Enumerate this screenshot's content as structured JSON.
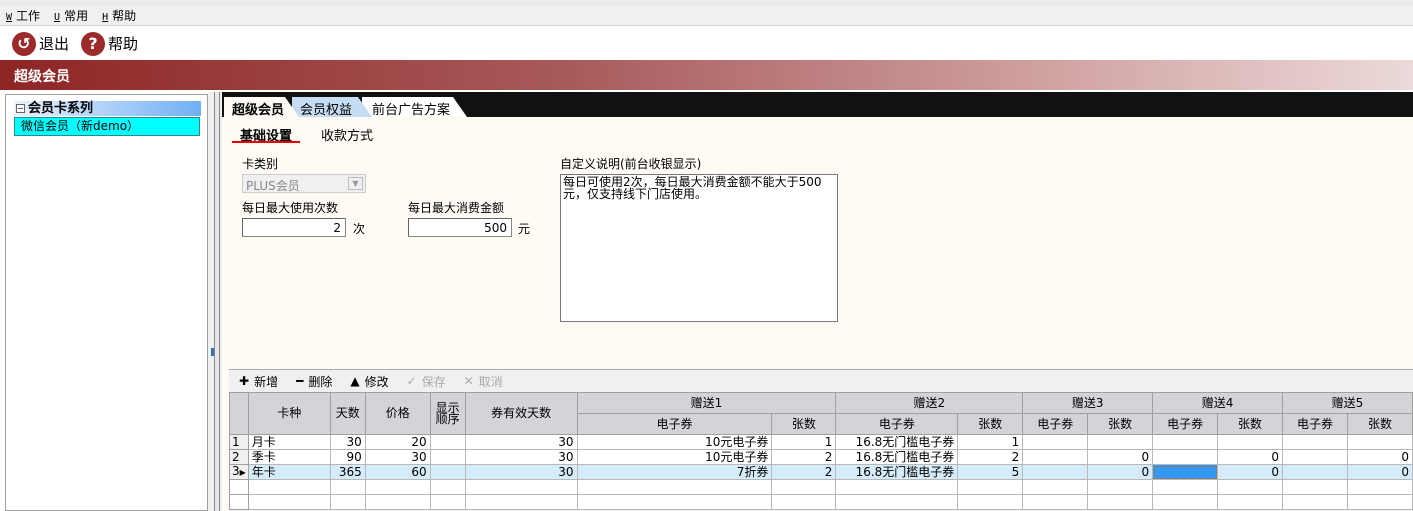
{
  "menu": [
    {
      "key": "W",
      "label": "工作"
    },
    {
      "key": "U",
      "label": "常用"
    },
    {
      "key": "H",
      "label": "帮助"
    }
  ],
  "toolbar": {
    "exit": "退出",
    "help": "帮助"
  },
  "header": {
    "title": "超级会员"
  },
  "tree": {
    "root": "会员卡系列",
    "item": "微信会员（新demo）"
  },
  "tabs": [
    "超级会员",
    "会员权益",
    "前台广告方案"
  ],
  "subtabs": [
    "基础设置",
    "收款方式"
  ],
  "form": {
    "card_type_label": "卡类别",
    "card_type_value": "PLUS会员",
    "max_uses_label": "每日最大使用次数",
    "max_uses_value": "2",
    "max_uses_unit": "次",
    "max_amount_label": "每日最大消费金额",
    "max_amount_value": "500",
    "max_amount_unit": "元",
    "memo_label": "自定义说明(前台收银显示)",
    "memo_value": "每日可使用2次，每日最大消费金额不能大于500元，仅支持线下门店使用。"
  },
  "grid_toolbar": {
    "add": "新增",
    "delete": "删除",
    "edit": "修改",
    "save": "保存",
    "cancel": "取消"
  },
  "grid": {
    "headers": {
      "card": "卡种",
      "days": "天数",
      "price": "价格",
      "order": "显示顺序",
      "valid": "券有效天数",
      "gift1": "赠送1",
      "gift2": "赠送2",
      "gift3": "赠送3",
      "gift4": "赠送4",
      "gift5": "赠送5",
      "coupon": "电子券",
      "count": "张数"
    },
    "rows": [
      {
        "n": "1",
        "card": "月卡",
        "days": "30",
        "price": "20",
        "order": "",
        "valid": "30",
        "g1c": "10元电子券",
        "g1n": "1",
        "g2c": "16.8无门槛电子券",
        "g2n": "1",
        "g3c": "",
        "g3n": "",
        "g4c": "",
        "g4n": "",
        "g5c": "",
        "g5n": ""
      },
      {
        "n": "2",
        "card": "季卡",
        "days": "90",
        "price": "30",
        "order": "",
        "valid": "30",
        "g1c": "10元电子券",
        "g1n": "2",
        "g2c": "16.8无门槛电子券",
        "g2n": "2",
        "g3c": "",
        "g3n": "0",
        "g4c": "",
        "g4n": "0",
        "g5c": "",
        "g5n": "0"
      },
      {
        "n": "3",
        "card": "年卡",
        "days": "365",
        "price": "60",
        "order": "",
        "valid": "30",
        "g1c": "7折券",
        "g1n": "2",
        "g2c": "16.8无门槛电子券",
        "g2n": "5",
        "g3c": "",
        "g3n": "0",
        "g4c": "",
        "g4n": "0",
        "g5c": "",
        "g5n": "0"
      }
    ]
  }
}
